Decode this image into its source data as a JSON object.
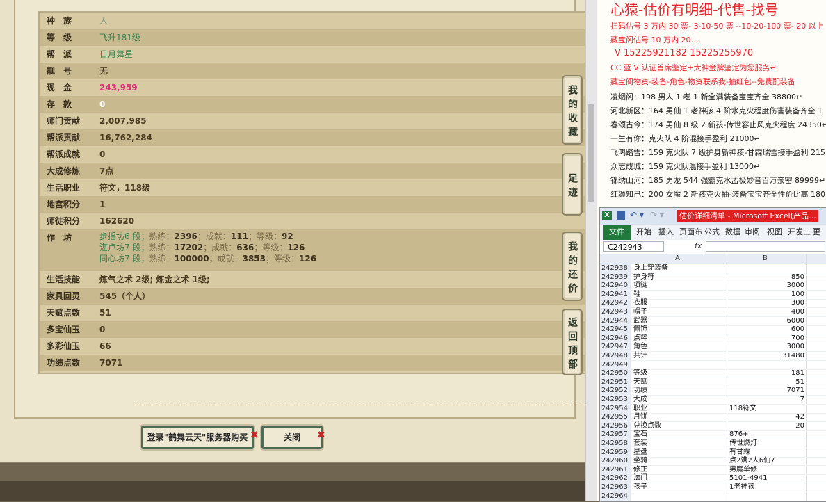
{
  "game": {
    "rows": [
      {
        "label": "种　族",
        "value": "人",
        "style": "light"
      },
      {
        "label": "等　级",
        "value": "飞升181级",
        "style": "green"
      },
      {
        "label": "帮　派",
        "value": "日月舞星",
        "style": "green"
      },
      {
        "label": "靓　号",
        "value": "无",
        "style": ""
      },
      {
        "label": "现　金",
        "value": "243,959",
        "style": "pink"
      },
      {
        "label": "存　款",
        "value": "0",
        "style": "white"
      },
      {
        "label": "师门贡献",
        "value": "2,007,985",
        "style": ""
      },
      {
        "label": "帮派贡献",
        "value": "16,762,284",
        "style": ""
      },
      {
        "label": "帮派成就",
        "value": "0",
        "style": ""
      },
      {
        "label": "大成修炼",
        "value": "7点",
        "style": ""
      },
      {
        "label": "生活职业",
        "value": "符文，118级",
        "style": ""
      },
      {
        "label": "地宫积分",
        "value": "1",
        "style": ""
      },
      {
        "label": "师徒积分",
        "value": "162620",
        "style": ""
      }
    ],
    "craft_label": "作　坊",
    "craft_lines": [
      {
        "name": "步摇坊",
        "seg": "6 段；",
        "sk": "熟练：",
        "skv": "2396",
        "ach": "；成就：",
        "achv": "111",
        "lvl": "；等级：",
        "lvlv": "92"
      },
      {
        "name": "湛卢坊",
        "seg": "7 段；",
        "sk": "熟练：",
        "skv": "17202",
        "ach": "；成就：",
        "achv": "636",
        "lvl": "；等级：",
        "lvlv": "126"
      },
      {
        "name": "同心坊",
        "seg": "7 段；",
        "sk": "熟练：",
        "skv": "100000",
        "ach": "；成就：",
        "achv": "3853",
        "lvl": "；等级：",
        "lvlv": "126"
      }
    ],
    "rows2": [
      {
        "label": "生活技能",
        "value": "炼气之术 2级; 炼金之术 1级;"
      },
      {
        "label": "家具回灵",
        "value": "545（个人）"
      },
      {
        "label": "天赋点数",
        "value": "51"
      },
      {
        "label": "多宝仙玉",
        "value": "0"
      },
      {
        "label": "多彩仙玉",
        "value": "66"
      },
      {
        "label": "功绩点数",
        "value": "7071"
      }
    ],
    "side_buttons": [
      "我的收藏",
      "足迹",
      "我的还价",
      "返回顶部"
    ],
    "buy_button": "登录\"鹤舞云天\"服务器购买",
    "close_button": "关闭",
    "x_mark": "✖"
  },
  "doc": {
    "title": "心猿-估价有明细-代售-找号",
    "lines": [
      {
        "text": "扫码估号 3 万内 30 票- 3-10-50 票  --10-20-100 票- 20 以上 150+",
        "style": "red"
      },
      {
        "text": "藏宝阁估号 10 万内 20…",
        "style": "red"
      },
      {
        "text": "V 15225921182    15225255970",
        "style": "redb"
      },
      {
        "text": "CC 蓝 V 认证首席鉴定+大神金牌鉴定为您服务↵",
        "style": "red"
      },
      {
        "text": "藏宝阁物资-装备-角色-物资联系我-抽红包--免费配装备",
        "style": "red"
      },
      {
        "text": "凌烟阁：198 男人 1 老 1 新全满装备宝宝齐全 38800↵",
        "style": "blk"
      },
      {
        "text": "河北新区：164 男仙 1 老神孩 4 阶水克火程度伤害装备齐全 1",
        "style": "blk"
      },
      {
        "text": "春颂古今：174 男仙 8 级 2 新孩-传世容止风克火程度 24350↵",
        "style": "blk"
      },
      {
        "text": "一生有你：克火队 4 阶混接手盈利 21000↵",
        "style": "blk"
      },
      {
        "text": "飞鸿踏雪：159 克火队 7 级护身新神孩-甘霖瑞雪接手盈利 215",
        "style": "blk"
      },
      {
        "text": "众志成城：159 克火队混接手盈利 13000↵",
        "style": "blk"
      },
      {
        "text": "锦绣山河：185 男龙 544 强霸克水孟极妙音百万亲密 89999↵",
        "style": "blk"
      },
      {
        "text": "红颜知己：200 女魔 2 新孩克火抽-装备宝宝齐全性价比高 180",
        "style": "blk"
      }
    ]
  },
  "excel": {
    "title": "估价详细清单 - Microsoft Excel(产品…",
    "logo": "X",
    "undo": "↶ ▾",
    "redo": "↷ ▾",
    "tabs": [
      "文件",
      "开始",
      "插入",
      "页面布",
      "公式",
      "数据",
      "审阅",
      "视图",
      "开发工",
      "更多"
    ],
    "namebox": "C242943",
    "fx": "fx",
    "col_a": "A",
    "col_b": "B",
    "rows": [
      {
        "n": "242938",
        "a": "身上穿装备",
        "b": ""
      },
      {
        "n": "242939",
        "a": "护身符",
        "b": "850"
      },
      {
        "n": "242940",
        "a": "项链",
        "b": "3000"
      },
      {
        "n": "242941",
        "a": "鞋",
        "b": "100"
      },
      {
        "n": "242942",
        "a": "衣服",
        "b": "300"
      },
      {
        "n": "242943",
        "a": "帽子",
        "b": "400"
      },
      {
        "n": "242944",
        "a": "武器",
        "b": "6000"
      },
      {
        "n": "242945",
        "a": "佩饰",
        "b": "600"
      },
      {
        "n": "242946",
        "a": "点粹",
        "b": "700"
      },
      {
        "n": "242947",
        "a": "角色",
        "b": "3000"
      },
      {
        "n": "242948",
        "a": "共计",
        "b": "31480"
      },
      {
        "n": "242949",
        "a": "",
        "b": ""
      },
      {
        "n": "242950",
        "a": "等级",
        "b": "181"
      },
      {
        "n": "242951",
        "a": "天赋",
        "b": "51"
      },
      {
        "n": "242952",
        "a": "功绩",
        "b": "7071"
      },
      {
        "n": "242953",
        "a": "大成",
        "b": "7"
      },
      {
        "n": "242954",
        "a": "职业",
        "b": "",
        "bl": "118符文"
      },
      {
        "n": "242955",
        "a": "月饼",
        "b": "42"
      },
      {
        "n": "242956",
        "a": "兑换点数",
        "b": "20"
      },
      {
        "n": "242957",
        "a": "宝石",
        "b": "",
        "bl": "876+"
      },
      {
        "n": "242958",
        "a": "套装",
        "b": "",
        "bl": "传世燃灯"
      },
      {
        "n": "242959",
        "a": "星盘",
        "b": "",
        "bl": "有甘霖"
      },
      {
        "n": "242960",
        "a": "坐骑",
        "b": "",
        "bl": "点2满2人6仙7"
      },
      {
        "n": "242961",
        "a": "修正",
        "b": "",
        "bl": "男魔单修"
      },
      {
        "n": "242962",
        "a": "法门",
        "b": "",
        "bl": "5101-4941"
      },
      {
        "n": "242963",
        "a": "孩子",
        "b": "",
        "bl": "1老神孩"
      },
      {
        "n": "242964",
        "a": "",
        "b": ""
      }
    ]
  }
}
